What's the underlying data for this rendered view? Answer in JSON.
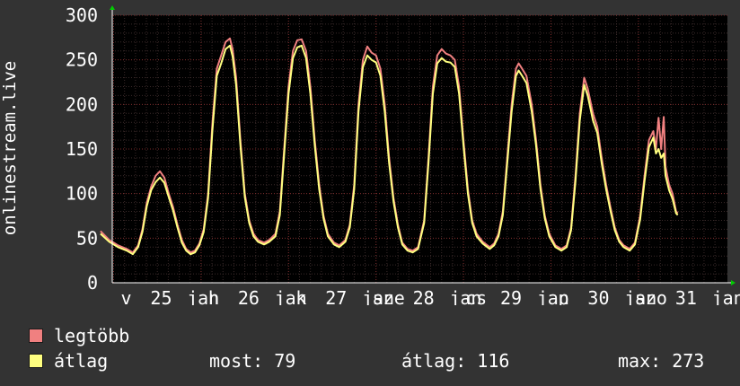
{
  "chart_data": {
    "type": "line",
    "ylabel": "onlinestream.live",
    "ylim": [
      0,
      300
    ],
    "yticks": [
      0,
      50,
      100,
      150,
      200,
      250,
      300
    ],
    "grid": true,
    "xticks": [
      {
        "label": "v",
        "x": 0.0
      },
      {
        "label": "25",
        "x": 0.4
      },
      {
        "label": "jan",
        "x": 0.88
      },
      {
        "label": "h",
        "x": 1.0
      },
      {
        "label": "26",
        "x": 1.4
      },
      {
        "label": "jan",
        "x": 1.88
      },
      {
        "label": "k",
        "x": 2.0
      },
      {
        "label": "27",
        "x": 2.4
      },
      {
        "label": "jan",
        "x": 2.88
      },
      {
        "label": "sze",
        "x": 3.0
      },
      {
        "label": "28",
        "x": 3.4
      },
      {
        "label": "jan",
        "x": 3.88
      },
      {
        "label": "cs",
        "x": 4.0
      },
      {
        "label": "29",
        "x": 4.4
      },
      {
        "label": "jan",
        "x": 4.88
      },
      {
        "label": "p",
        "x": 5.0
      },
      {
        "label": "30",
        "x": 5.4
      },
      {
        "label": "jan",
        "x": 5.88
      },
      {
        "label": "szo",
        "x": 6.0
      },
      {
        "label": "31",
        "x": 6.4
      },
      {
        "label": "jan",
        "x": 6.88
      }
    ],
    "series": [
      {
        "name": "legtöbb",
        "color": "#f08080",
        "points": [
          [
            -0.15,
            58
          ],
          [
            -0.05,
            48
          ],
          [
            0.05,
            42
          ],
          [
            0.15,
            38
          ],
          [
            0.22,
            34
          ],
          [
            0.28,
            42
          ],
          [
            0.33,
            60
          ],
          [
            0.38,
            90
          ],
          [
            0.43,
            108
          ],
          [
            0.48,
            120
          ],
          [
            0.53,
            125
          ],
          [
            0.58,
            118
          ],
          [
            0.63,
            100
          ],
          [
            0.68,
            85
          ],
          [
            0.73,
            65
          ],
          [
            0.78,
            48
          ],
          [
            0.83,
            38
          ],
          [
            0.88,
            34
          ],
          [
            0.93,
            36
          ],
          [
            0.98,
            44
          ],
          [
            1.03,
            60
          ],
          [
            1.08,
            100
          ],
          [
            1.13,
            180
          ],
          [
            1.18,
            240
          ],
          [
            1.23,
            255
          ],
          [
            1.28,
            270
          ],
          [
            1.33,
            274
          ],
          [
            1.36,
            262
          ],
          [
            1.4,
            230
          ],
          [
            1.45,
            160
          ],
          [
            1.5,
            100
          ],
          [
            1.55,
            70
          ],
          [
            1.6,
            55
          ],
          [
            1.65,
            48
          ],
          [
            1.72,
            45
          ],
          [
            1.78,
            48
          ],
          [
            1.85,
            55
          ],
          [
            1.9,
            80
          ],
          [
            1.95,
            150
          ],
          [
            2.0,
            220
          ],
          [
            2.05,
            260
          ],
          [
            2.1,
            272
          ],
          [
            2.15,
            273
          ],
          [
            2.2,
            260
          ],
          [
            2.25,
            220
          ],
          [
            2.3,
            160
          ],
          [
            2.35,
            110
          ],
          [
            2.4,
            75
          ],
          [
            2.45,
            55
          ],
          [
            2.52,
            45
          ],
          [
            2.58,
            42
          ],
          [
            2.65,
            48
          ],
          [
            2.7,
            65
          ],
          [
            2.75,
            110
          ],
          [
            2.8,
            200
          ],
          [
            2.85,
            250
          ],
          [
            2.9,
            265
          ],
          [
            2.95,
            258
          ],
          [
            3.0,
            255
          ],
          [
            3.05,
            240
          ],
          [
            3.1,
            200
          ],
          [
            3.15,
            140
          ],
          [
            3.2,
            95
          ],
          [
            3.25,
            65
          ],
          [
            3.3,
            45
          ],
          [
            3.36,
            38
          ],
          [
            3.42,
            36
          ],
          [
            3.48,
            40
          ],
          [
            3.55,
            70
          ],
          [
            3.6,
            140
          ],
          [
            3.65,
            220
          ],
          [
            3.7,
            255
          ],
          [
            3.75,
            262
          ],
          [
            3.8,
            257
          ],
          [
            3.85,
            255
          ],
          [
            3.9,
            250
          ],
          [
            3.95,
            220
          ],
          [
            4.0,
            160
          ],
          [
            4.05,
            105
          ],
          [
            4.1,
            70
          ],
          [
            4.15,
            55
          ],
          [
            4.22,
            46
          ],
          [
            4.3,
            40
          ],
          [
            4.35,
            44
          ],
          [
            4.4,
            55
          ],
          [
            4.45,
            80
          ],
          [
            4.5,
            140
          ],
          [
            4.55,
            200
          ],
          [
            4.6,
            240
          ],
          [
            4.63,
            246
          ],
          [
            4.67,
            240
          ],
          [
            4.72,
            232
          ],
          [
            4.78,
            200
          ],
          [
            4.83,
            160
          ],
          [
            4.88,
            110
          ],
          [
            4.93,
            75
          ],
          [
            4.98,
            55
          ],
          [
            5.05,
            42
          ],
          [
            5.12,
            38
          ],
          [
            5.18,
            42
          ],
          [
            5.23,
            62
          ],
          [
            5.28,
            120
          ],
          [
            5.33,
            190
          ],
          [
            5.38,
            230
          ],
          [
            5.42,
            218
          ],
          [
            5.48,
            190
          ],
          [
            5.53,
            175
          ],
          [
            5.58,
            140
          ],
          [
            5.63,
            110
          ],
          [
            5.68,
            85
          ],
          [
            5.73,
            62
          ],
          [
            5.78,
            48
          ],
          [
            5.83,
            42
          ],
          [
            5.9,
            38
          ],
          [
            5.96,
            45
          ],
          [
            6.02,
            75
          ],
          [
            6.07,
            120
          ],
          [
            6.12,
            160
          ],
          [
            6.17,
            170
          ],
          [
            6.2,
            150
          ],
          [
            6.23,
            185
          ],
          [
            6.26,
            150
          ],
          [
            6.29,
            186
          ],
          [
            6.31,
            130
          ],
          [
            6.35,
            110
          ],
          [
            6.39,
            100
          ],
          [
            6.43,
            80
          ],
          [
            6.45,
            78
          ]
        ]
      },
      {
        "name": "átlag",
        "color": "#ffff80",
        "points": [
          [
            -0.15,
            55
          ],
          [
            -0.05,
            46
          ],
          [
            0.05,
            40
          ],
          [
            0.15,
            36
          ],
          [
            0.22,
            32
          ],
          [
            0.28,
            40
          ],
          [
            0.33,
            57
          ],
          [
            0.38,
            86
          ],
          [
            0.43,
            104
          ],
          [
            0.48,
            113
          ],
          [
            0.53,
            118
          ],
          [
            0.58,
            112
          ],
          [
            0.63,
            96
          ],
          [
            0.68,
            81
          ],
          [
            0.73,
            62
          ],
          [
            0.78,
            45
          ],
          [
            0.83,
            36
          ],
          [
            0.88,
            32
          ],
          [
            0.93,
            34
          ],
          [
            0.98,
            42
          ],
          [
            1.03,
            57
          ],
          [
            1.08,
            95
          ],
          [
            1.13,
            172
          ],
          [
            1.18,
            232
          ],
          [
            1.23,
            246
          ],
          [
            1.28,
            262
          ],
          [
            1.33,
            266
          ],
          [
            1.36,
            254
          ],
          [
            1.4,
            222
          ],
          [
            1.45,
            154
          ],
          [
            1.5,
            96
          ],
          [
            1.55,
            67
          ],
          [
            1.6,
            52
          ],
          [
            1.65,
            46
          ],
          [
            1.72,
            43
          ],
          [
            1.78,
            46
          ],
          [
            1.85,
            52
          ],
          [
            1.9,
            76
          ],
          [
            1.95,
            144
          ],
          [
            2.0,
            212
          ],
          [
            2.05,
            252
          ],
          [
            2.1,
            264
          ],
          [
            2.15,
            266
          ],
          [
            2.2,
            252
          ],
          [
            2.25,
            212
          ],
          [
            2.3,
            154
          ],
          [
            2.35,
            105
          ],
          [
            2.4,
            72
          ],
          [
            2.45,
            52
          ],
          [
            2.52,
            43
          ],
          [
            2.58,
            40
          ],
          [
            2.65,
            46
          ],
          [
            2.7,
            62
          ],
          [
            2.75,
            105
          ],
          [
            2.8,
            192
          ],
          [
            2.85,
            242
          ],
          [
            2.9,
            255
          ],
          [
            2.95,
            250
          ],
          [
            3.0,
            247
          ],
          [
            3.05,
            232
          ],
          [
            3.1,
            192
          ],
          [
            3.15,
            134
          ],
          [
            3.2,
            91
          ],
          [
            3.25,
            62
          ],
          [
            3.3,
            43
          ],
          [
            3.36,
            36
          ],
          [
            3.42,
            34
          ],
          [
            3.48,
            38
          ],
          [
            3.55,
            67
          ],
          [
            3.6,
            134
          ],
          [
            3.65,
            212
          ],
          [
            3.7,
            246
          ],
          [
            3.75,
            252
          ],
          [
            3.8,
            248
          ],
          [
            3.85,
            247
          ],
          [
            3.9,
            242
          ],
          [
            3.95,
            212
          ],
          [
            4.0,
            154
          ],
          [
            4.05,
            100
          ],
          [
            4.1,
            67
          ],
          [
            4.15,
            52
          ],
          [
            4.22,
            44
          ],
          [
            4.3,
            38
          ],
          [
            4.35,
            42
          ],
          [
            4.4,
            52
          ],
          [
            4.45,
            76
          ],
          [
            4.5,
            134
          ],
          [
            4.55,
            192
          ],
          [
            4.6,
            232
          ],
          [
            4.63,
            238
          ],
          [
            4.67,
            232
          ],
          [
            4.72,
            224
          ],
          [
            4.78,
            192
          ],
          [
            4.83,
            154
          ],
          [
            4.88,
            105
          ],
          [
            4.93,
            72
          ],
          [
            4.98,
            52
          ],
          [
            5.05,
            40
          ],
          [
            5.12,
            36
          ],
          [
            5.18,
            40
          ],
          [
            5.23,
            59
          ],
          [
            5.28,
            114
          ],
          [
            5.33,
            182
          ],
          [
            5.38,
            222
          ],
          [
            5.42,
            210
          ],
          [
            5.48,
            182
          ],
          [
            5.53,
            168
          ],
          [
            5.58,
            134
          ],
          [
            5.63,
            105
          ],
          [
            5.68,
            81
          ],
          [
            5.73,
            59
          ],
          [
            5.78,
            46
          ],
          [
            5.83,
            40
          ],
          [
            5.9,
            36
          ],
          [
            5.96,
            43
          ],
          [
            6.02,
            71
          ],
          [
            6.07,
            114
          ],
          [
            6.12,
            152
          ],
          [
            6.17,
            163
          ],
          [
            6.2,
            145
          ],
          [
            6.23,
            150
          ],
          [
            6.26,
            140
          ],
          [
            6.29,
            145
          ],
          [
            6.31,
            120
          ],
          [
            6.35,
            104
          ],
          [
            6.39,
            94
          ],
          [
            6.43,
            78
          ],
          [
            6.45,
            76
          ]
        ]
      }
    ],
    "xlim": [
      -0.15,
      6.9
    ]
  },
  "legend": [
    {
      "label": "legtöbb",
      "color": "#f08080"
    },
    {
      "label": "átlag",
      "color": "#ffff80"
    }
  ],
  "stats": {
    "most": "most: 79",
    "atlag": "átlag: 116",
    "max": "max: 273"
  }
}
